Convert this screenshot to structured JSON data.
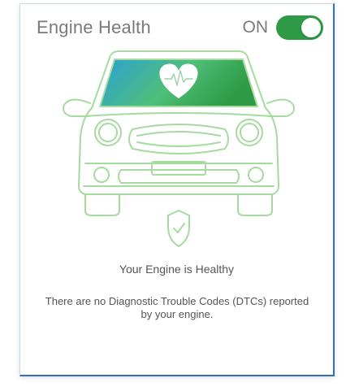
{
  "card": {
    "title": "Engine Health",
    "toggle": {
      "state_label": "ON",
      "is_on": true,
      "color": "#2e9a45"
    }
  },
  "illustration": {
    "subject": "car-front",
    "line_color": "#a6dba0",
    "windshield_gradient": [
      "#2aa0d8",
      "#4fbf7a",
      "#2e9a45"
    ],
    "icons": [
      "heart-pulse-icon",
      "shield-check-icon"
    ]
  },
  "status": {
    "headline": "Your Engine is Healthy",
    "description": "There are no Diagnostic Trouble Codes (DTCs) reported by your engine."
  }
}
